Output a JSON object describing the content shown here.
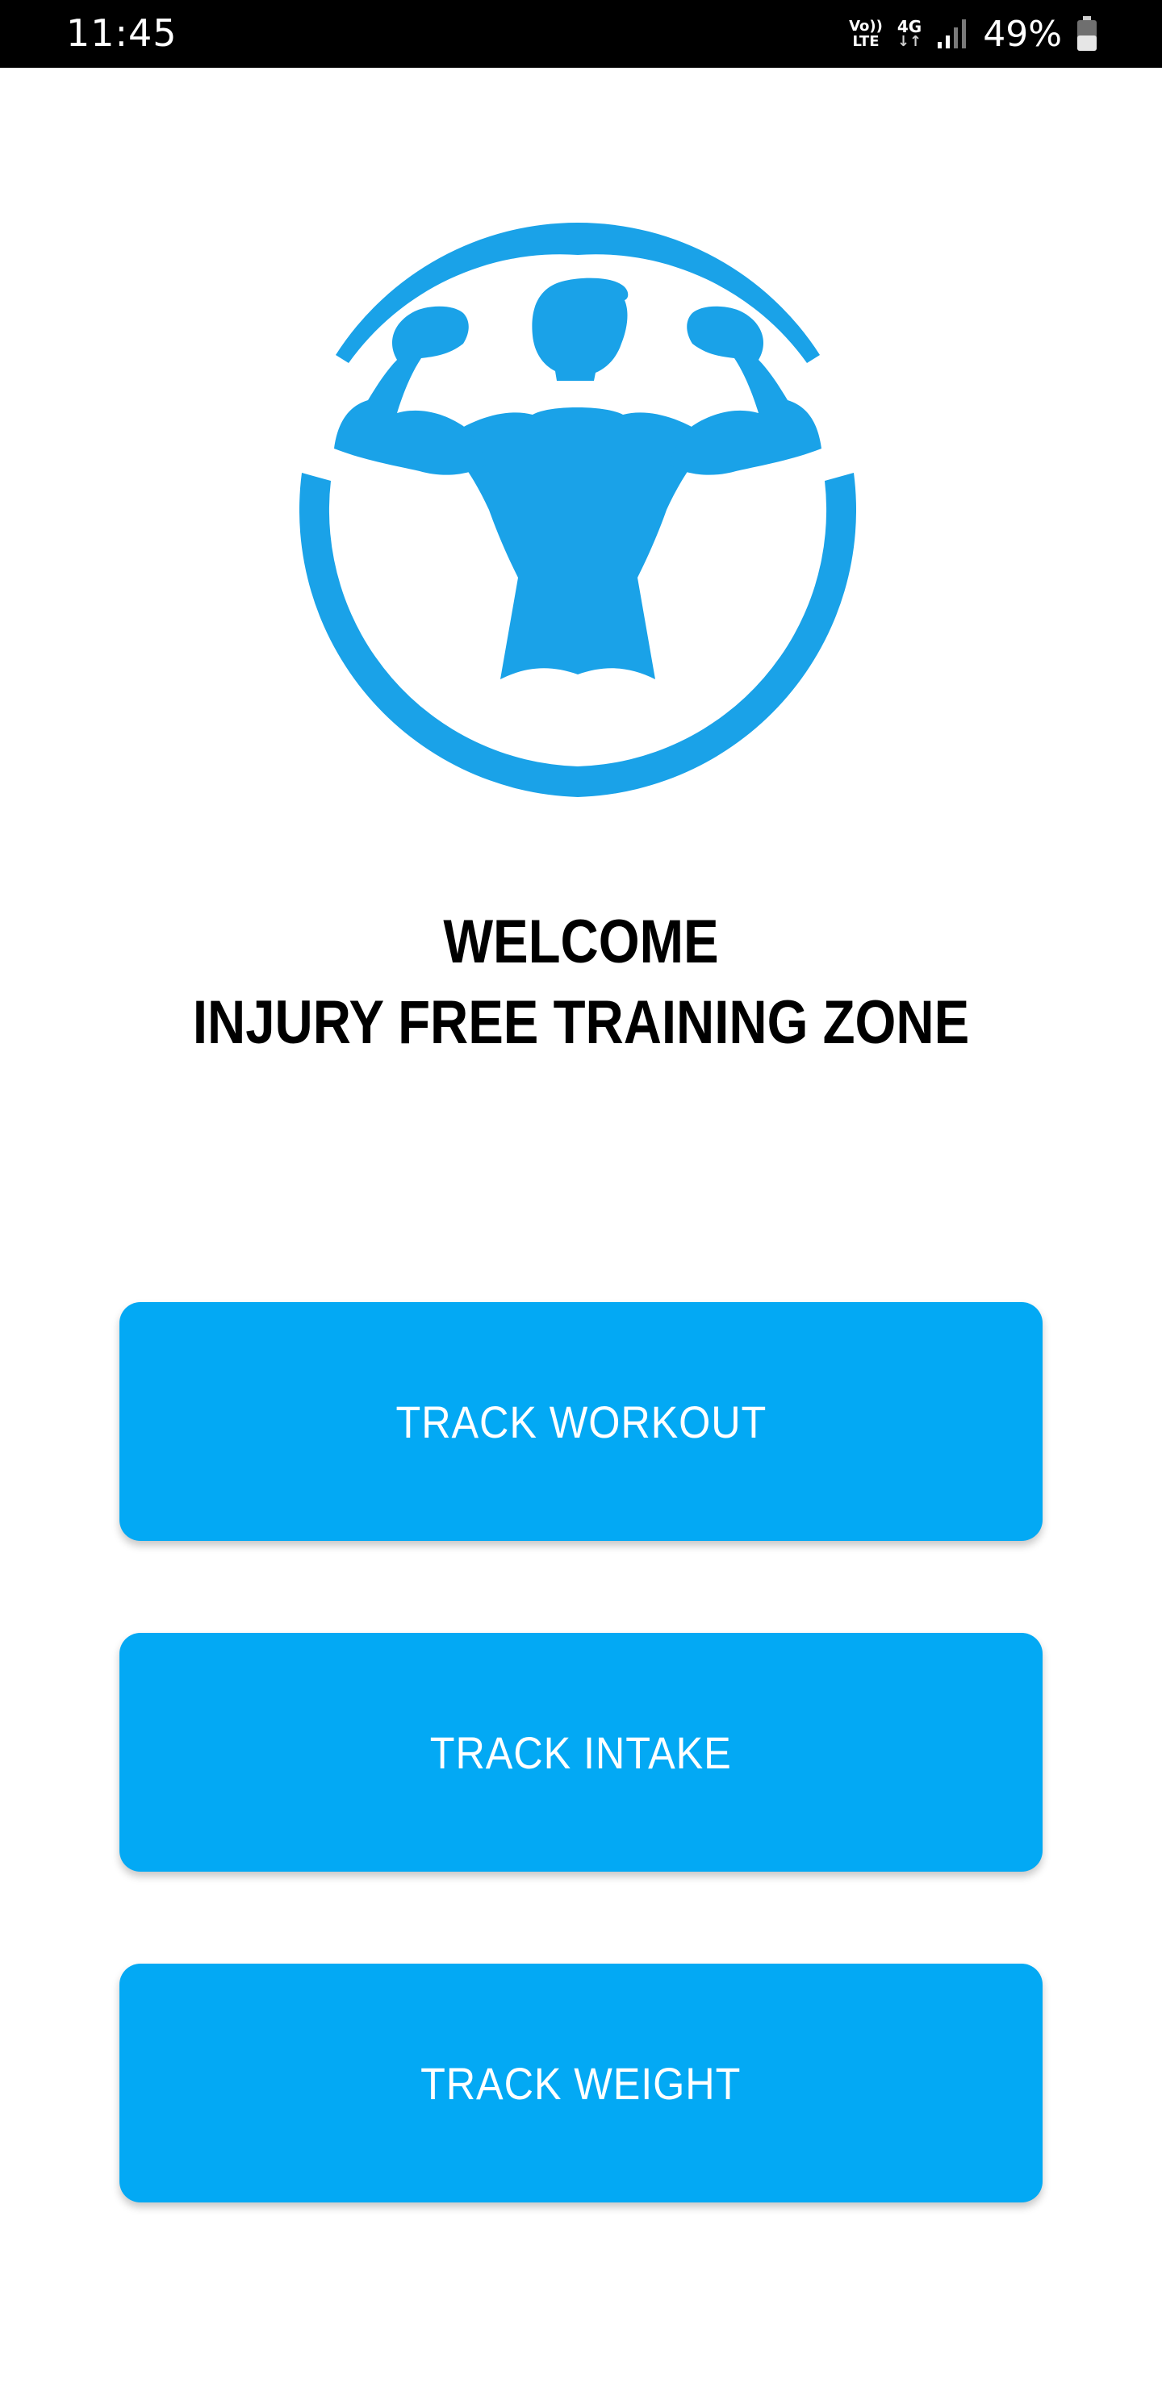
{
  "status_bar": {
    "time": "11:45",
    "volte_top": "Vo))",
    "volte_bottom": "LTE",
    "network_type": "4G",
    "network_arrows": "↓↑",
    "battery_percent": "49%",
    "battery_level": 0.49
  },
  "logo": {
    "icon": "bodybuilder-icon",
    "color": "#1aa2e8"
  },
  "welcome": {
    "line1": "WELCOME",
    "line2": "INJURY FREE TRAINING ZONE"
  },
  "buttons": {
    "track_workout": "TRACK WORKOUT",
    "track_intake": "TRACK INTAKE",
    "track_weight": "TRACK WEIGHT"
  },
  "colors": {
    "accent": "#03a9f4",
    "logo": "#1aa2e8",
    "status_bar_bg": "#000000"
  }
}
